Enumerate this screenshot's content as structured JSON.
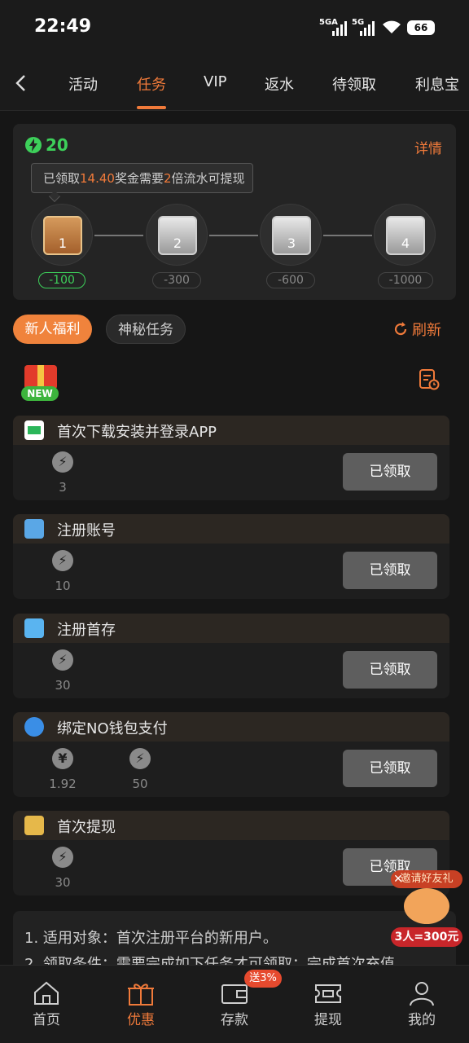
{
  "status_bar": {
    "time": "22:49",
    "signal1": "5GA",
    "signal2": "5G",
    "battery": "66"
  },
  "tabs": [
    {
      "label": "活动"
    },
    {
      "label": "任务",
      "active": true
    },
    {
      "label": "VIP"
    },
    {
      "label": "返水"
    },
    {
      "label": "待领取"
    },
    {
      "label": "利息宝"
    }
  ],
  "summary": {
    "points": "20",
    "details_label": "详情",
    "tip_prefix": "已领取",
    "tip_amount": "14.40",
    "tip_mid": "奖金需要",
    "tip_multiplier": "2",
    "tip_suffix": "倍流水可提现"
  },
  "chests": [
    {
      "number": "1",
      "label": "-100",
      "unlocked": true
    },
    {
      "number": "2",
      "label": "-300",
      "unlocked": false
    },
    {
      "number": "3",
      "label": "-600",
      "unlocked": false
    },
    {
      "number": "4",
      "label": "-1000",
      "unlocked": false
    }
  ],
  "filters": {
    "active": "新人福利",
    "inactive": "神秘任务",
    "refresh": "刷新"
  },
  "gift_badge": "NEW",
  "tasks": [
    {
      "title": "首次下载安装并登录APP",
      "rewards": [
        {
          "icon": "bolt-icon",
          "value": "3"
        }
      ],
      "button": "已领取",
      "icon_color": "#2bb65a"
    },
    {
      "title": "注册账号",
      "rewards": [
        {
          "icon": "bolt-icon",
          "value": "10"
        }
      ],
      "button": "已领取",
      "icon_color": "#5aa7e6"
    },
    {
      "title": "注册首存",
      "rewards": [
        {
          "icon": "bolt-icon",
          "value": "30"
        }
      ],
      "button": "已领取",
      "icon_color": "#5ab4f0"
    },
    {
      "title": "绑定NO钱包支付",
      "rewards": [
        {
          "icon": "yen-icon",
          "symbol": "¥",
          "value": "1.92"
        },
        {
          "icon": "bolt-icon",
          "value": "50"
        }
      ],
      "button": "已领取",
      "icon_color": "#3a8ee6"
    },
    {
      "title": "首次提现",
      "rewards": [
        {
          "icon": "bolt-icon",
          "value": "30"
        }
      ],
      "button": "已领取",
      "icon_color": "#e6b84a"
    }
  ],
  "rules": {
    "line1_label": "1. 适用对象：",
    "line1_text": "首次注册平台的新用户。",
    "line2_label": "2. 领取条件：",
    "line2_text": "需要完成如下任务才可领取：完成首次充值"
  },
  "promo": {
    "top": "邀请好友礼",
    "bottom": "3人=300元"
  },
  "bottom_nav": [
    {
      "label": "首页"
    },
    {
      "label": "优惠",
      "active": true
    },
    {
      "label": "存款",
      "badge": "送3%"
    },
    {
      "label": "提现"
    },
    {
      "label": "我的"
    }
  ],
  "colors": {
    "accent": "#f07a3a",
    "green": "#3dd05a",
    "bg": "#161616",
    "card": "#242424",
    "button": "#5e5e5e"
  }
}
